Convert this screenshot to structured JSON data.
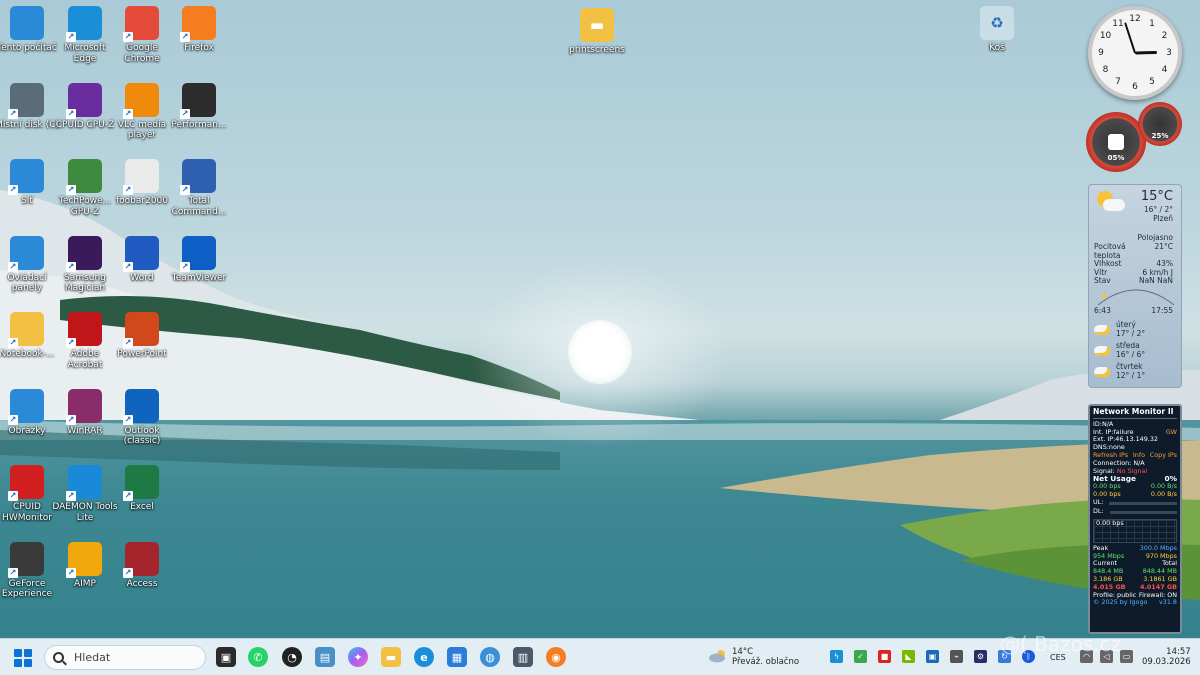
{
  "desktop": {
    "icons": [
      {
        "label": "Tento počítač",
        "icon": "computer-icon",
        "color": "#2a8ad8"
      },
      {
        "label": "Microsoft Edge",
        "icon": "edge-icon",
        "color": "#1a8fd8"
      },
      {
        "label": "Google Chrome",
        "icon": "chrome-icon",
        "color": "#e44b3a"
      },
      {
        "label": "Firefox",
        "icon": "firefox-icon",
        "color": "#f57c1f"
      },
      {
        "label": "Místní disk (C)",
        "icon": "drive-icon",
        "color": "#5a6c7a"
      },
      {
        "label": "CPUID CPU-Z",
        "icon": "cpuz-icon",
        "color": "#6a2da0"
      },
      {
        "label": "VLC media player",
        "icon": "vlc-icon",
        "color": "#f08a0c"
      },
      {
        "label": "Performan...",
        "icon": "performance-icon",
        "color": "#2c2c2c"
      },
      {
        "label": "Síť",
        "icon": "network-icon",
        "color": "#2a8ad8"
      },
      {
        "label": "TechPowe... GPU-Z",
        "icon": "gpuz-icon",
        "color": "#3e8a3e"
      },
      {
        "label": "foobar2000",
        "icon": "foobar-icon",
        "color": "#eaeaea"
      },
      {
        "label": "Total Command...",
        "icon": "totalcommander-icon",
        "color": "#2f5faf"
      },
      {
        "label": "Ovládací panely",
        "icon": "controlpanel-icon",
        "color": "#2a8ad8"
      },
      {
        "label": "Samsung Magician",
        "icon": "magician-icon",
        "color": "#3a1a5a"
      },
      {
        "label": "Word",
        "icon": "word-icon",
        "color": "#1f5bc0"
      },
      {
        "label": "TeamViewer",
        "icon": "teamviewer-icon",
        "color": "#0d5fc5"
      },
      {
        "label": "Notebook-...",
        "icon": "folder-icon",
        "color": "#f2c144"
      },
      {
        "label": "Adobe Acrobat",
        "icon": "acrobat-icon",
        "color": "#c0161a"
      },
      {
        "label": "PowerPoint",
        "icon": "powerpoint-icon",
        "color": "#d2481d"
      },
      {
        "label": "",
        "icon": "blank-icon",
        "color": ""
      },
      {
        "label": "Obrázky",
        "icon": "pictures-icon",
        "color": "#2a8ad8"
      },
      {
        "label": "WinRAR",
        "icon": "winrar-icon",
        "color": "#8a2c6a"
      },
      {
        "label": "Outlook (classic)",
        "icon": "outlook-icon",
        "color": "#0f64c0"
      },
      {
        "label": "",
        "icon": "blank-icon",
        "color": ""
      },
      {
        "label": "CPUID HWMonitor",
        "icon": "hwmonitor-icon",
        "color": "#d11e1e"
      },
      {
        "label": "DAEMON Tools Lite",
        "icon": "daemon-icon",
        "color": "#1a8ad8"
      },
      {
        "label": "Excel",
        "icon": "excel-icon",
        "color": "#1d7a45"
      },
      {
        "label": "",
        "icon": "blank-icon",
        "color": ""
      },
      {
        "label": "GeForce Experience",
        "icon": "geforce-icon",
        "color": "#3a3a3a"
      },
      {
        "label": "AIMP",
        "icon": "aimp-icon",
        "color": "#f0a80c"
      },
      {
        "label": "Access",
        "icon": "access-icon",
        "color": "#a4262c"
      }
    ],
    "printscreens": {
      "label": "printscreens",
      "icon": "folder-icon"
    },
    "recycle_bin": {
      "label": "Koš",
      "icon": "recycle-bin-icon"
    }
  },
  "clock_gadget": {
    "numbers": [
      "12",
      "1",
      "2",
      "3",
      "4",
      "5",
      "6",
      "7",
      "8",
      "9",
      "10",
      "11"
    ],
    "time": "14:57"
  },
  "cpu_gadget": {
    "cpu": "05%",
    "ram": "25%"
  },
  "weather_gadget": {
    "temp": "15°C",
    "range": "16° / 2°",
    "city": "Plzeň",
    "condition": "Polojasno",
    "rows": [
      {
        "k": "Pocitová teplota",
        "v": "21°C"
      },
      {
        "k": "Vlhkost",
        "v": "43%"
      },
      {
        "k": "Vítr",
        "v": "6 km/h J"
      },
      {
        "k": "Stav",
        "v": "NaN NaN"
      }
    ],
    "sunrise": "6:43",
    "sunset": "17:55",
    "forecast": [
      {
        "day": "úterý",
        "temp": "17° / 2°"
      },
      {
        "day": "středa",
        "temp": "16° / 6°"
      },
      {
        "day": "čtvrtek",
        "temp": "12° / 1°"
      }
    ]
  },
  "network_monitor": {
    "title": "Network Monitor II",
    "id": "ID:N/A",
    "int_ip": "Int. IP:failure",
    "ext_ip": "Ext. IP:46.13.149.32",
    "ext_code": "GW",
    "dns": "DNS:none",
    "links": [
      "Refresh IPs",
      "Info",
      "Copy IPs"
    ],
    "connection": "Connection: N/A",
    "signal_label": "Signal:",
    "signal_value": "No Signal",
    "net_usage": "Net Usage",
    "net_usage_pct": "0%",
    "up_bps": "0.00 bps",
    "up_bs": "0.00 B/s",
    "down_bps": "0.00 bps",
    "down_bs": "0.00 B/s",
    "ul": "UL:",
    "dl": "DL:",
    "graph_label": "0.00 bps",
    "peak_label": "Peak",
    "peak_value": "300.0 Mbps",
    "peak_up": "954 Mbps",
    "peak_down": "970 Mbps",
    "current_label": "Current",
    "total_label": "Total",
    "cur_up": "848.4 MB",
    "cur_down": "3.186 GB",
    "tot_up": "848.44 MB",
    "tot_down": "3.1861 GB",
    "sum_cur": "4.015 GB",
    "sum_tot": "4.0147 GB",
    "profile": "Profile: public",
    "firewall": "Firewall: ON",
    "footer": "© 2025 by Igogo",
    "version": "v31.8"
  },
  "taskbar": {
    "search_placeholder": "Hledat",
    "weather_temp": "14°C",
    "weather_text": "Převáž. oblačno",
    "lang": "CES",
    "time": "14:57",
    "date": "09.03.2026",
    "apps": [
      "task-view-icon",
      "whatsapp-icon",
      "speedometer-icon",
      "photos-icon",
      "copilot-icon",
      "explorer-icon",
      "edge-icon",
      "store-icon",
      "globe-icon",
      "calculator-icon",
      "firefox-icon"
    ]
  },
  "watermark": "@( Bazos.cz"
}
